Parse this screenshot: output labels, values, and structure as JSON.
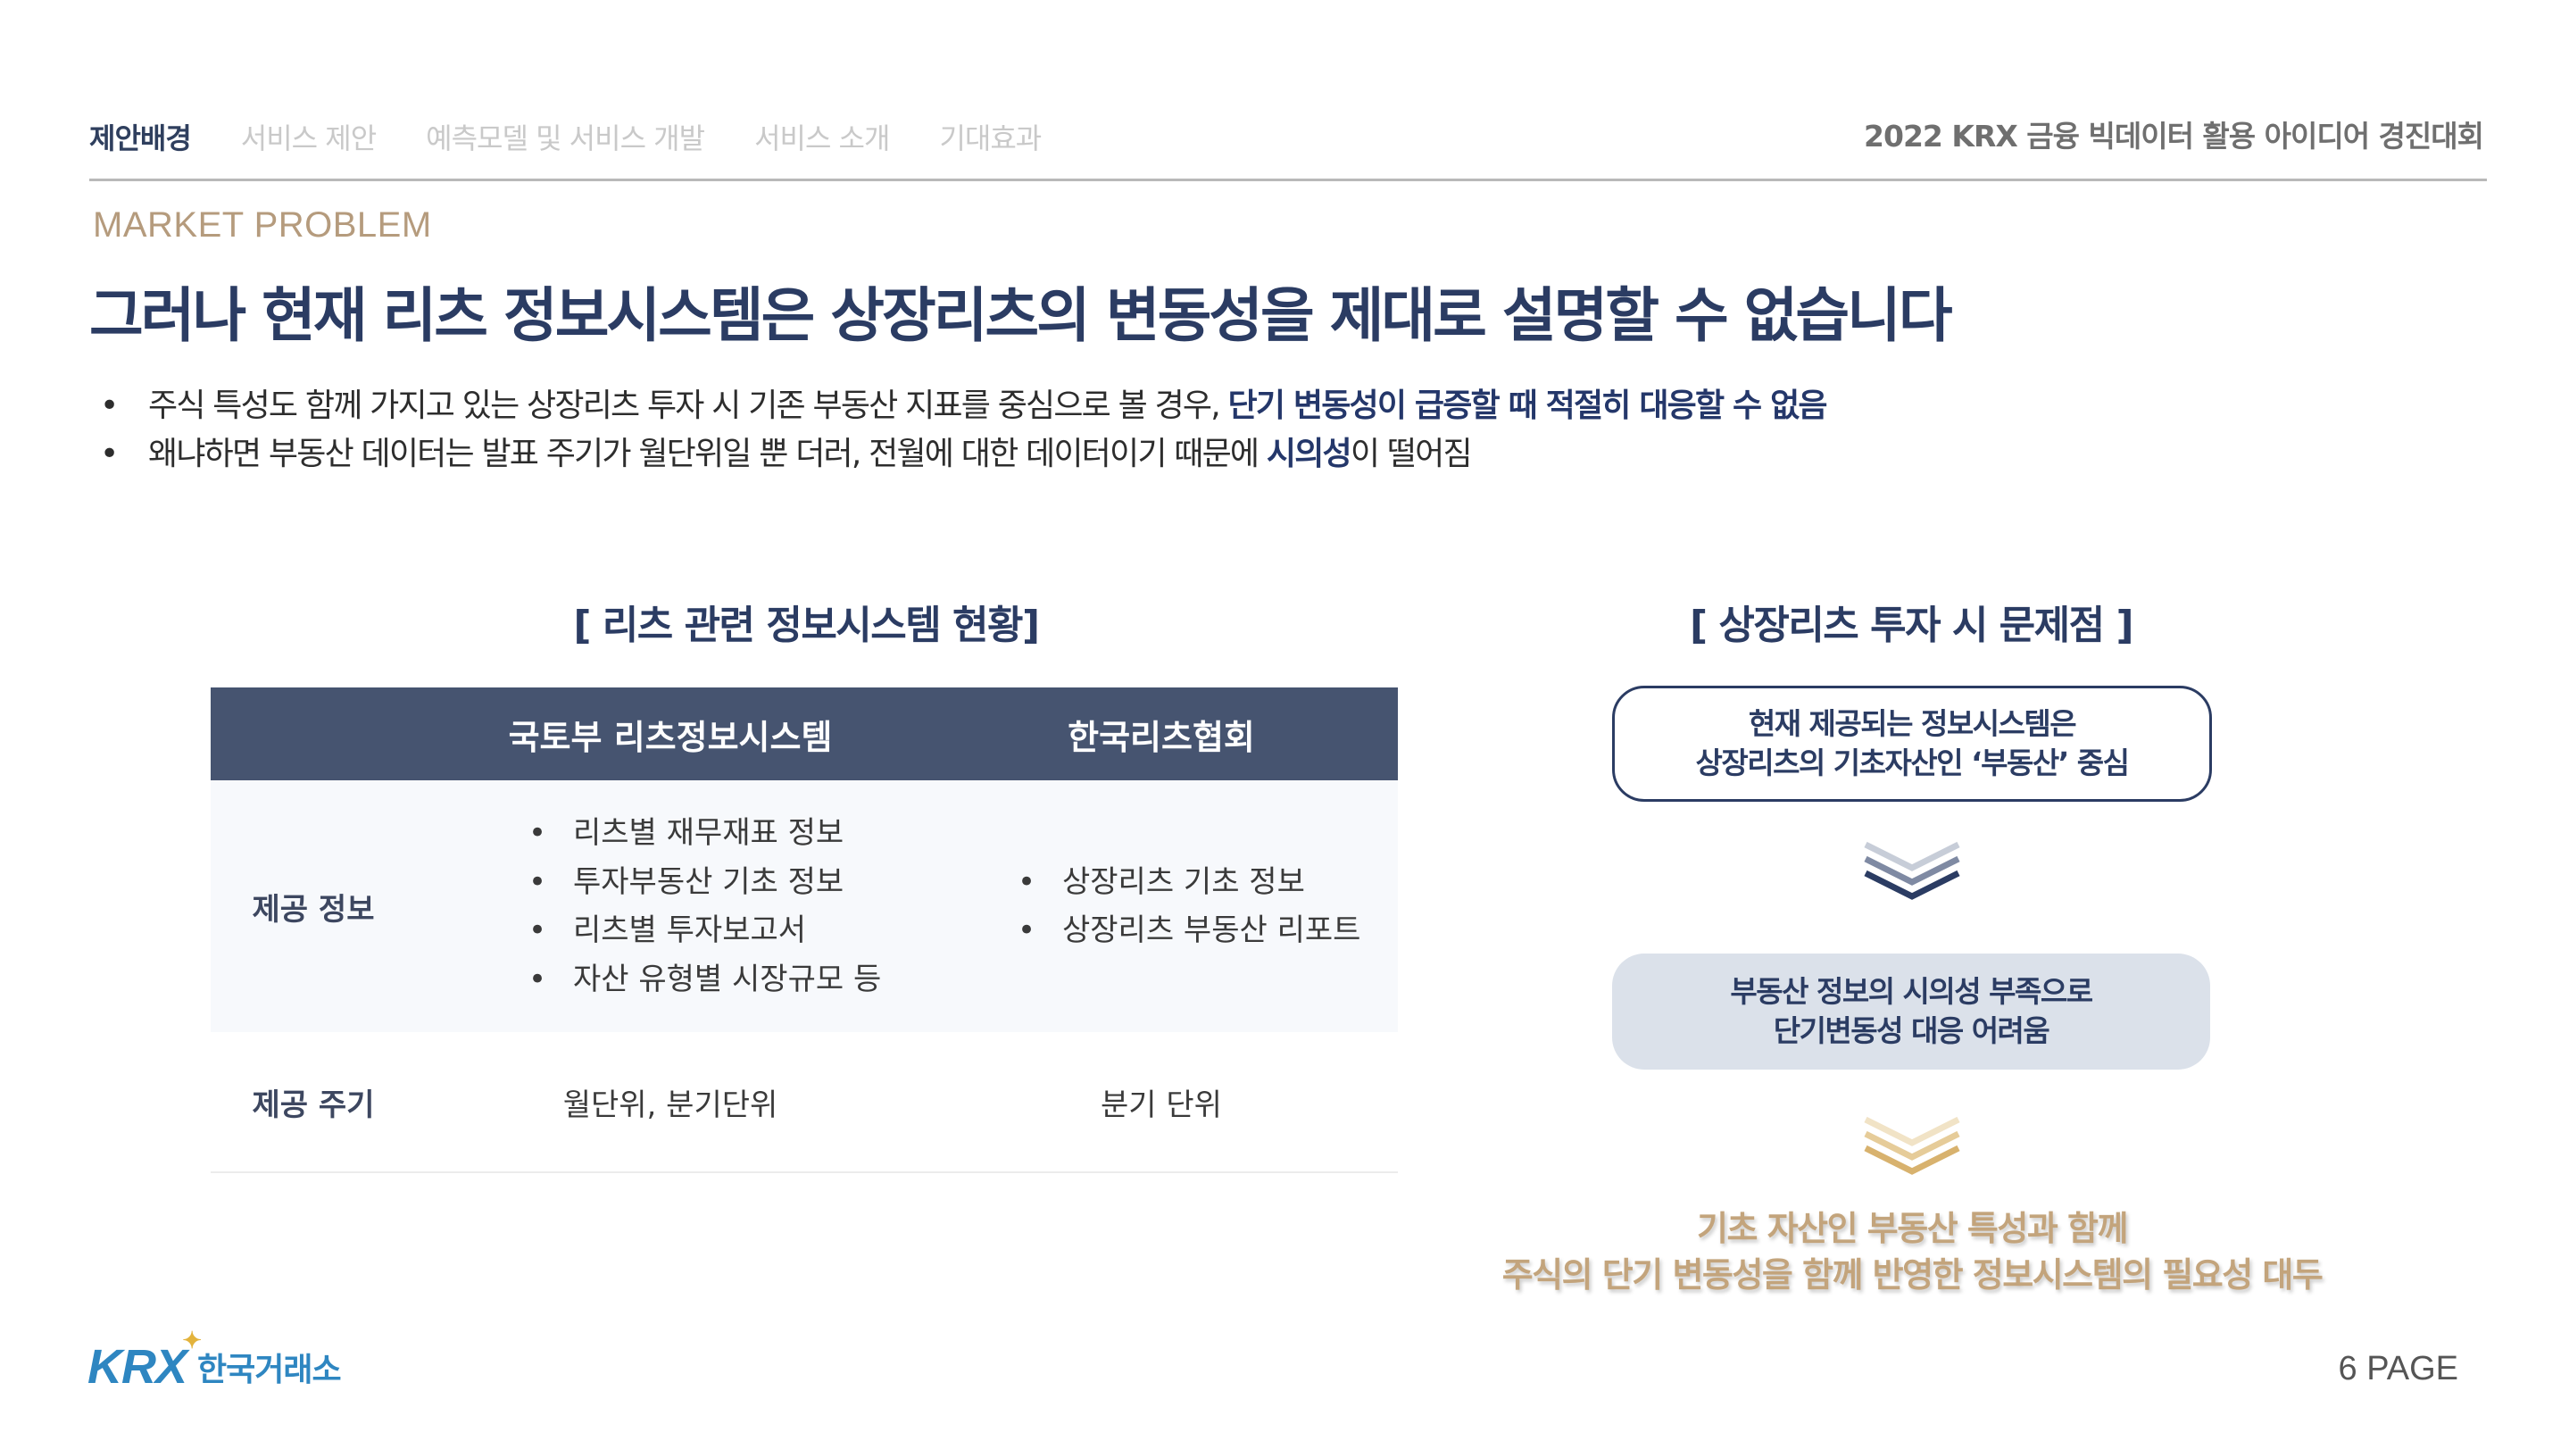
{
  "nav": {
    "tabs": [
      {
        "label": "제안배경",
        "active": true
      },
      {
        "label": "서비스 제안",
        "active": false
      },
      {
        "label": "예측모델 및 서비스 개발",
        "active": false
      },
      {
        "label": "서비스 소개",
        "active": false
      },
      {
        "label": "기대효과",
        "active": false
      }
    ],
    "event_name": "2022 KRX 금융 빅데이터 활용 아이디어 경진대회"
  },
  "section_label": "MARKET PROBLEM",
  "headline": "그러나 현재 리츠 정보시스템은 상장리츠의 변동성을 제대로 설명할 수 없습니다",
  "bullets": [
    {
      "text": "주식 특성도 함께 가지고 있는 상장리츠 투자 시 기존 부동산 지표를 중심으로 볼 경우, ",
      "highlight": "단기 변동성이 급증할 때 적절히 대응할 수 없음",
      "tail": ""
    },
    {
      "text": "왜냐하면 부동산 데이터는 발표 주기가 월단위일 뿐 더러, 전월에 대한 데이터이기 때문에 ",
      "highlight": "시의성",
      "tail": "이 떨어짐"
    }
  ],
  "left_title": "[ 리츠 관련 정보시스템 현황]",
  "right_title": "[ 상장리츠 투자 시 문제점 ]",
  "table": {
    "headers": [
      "",
      "국토부 리츠정보시스템",
      "한국리츠협회"
    ],
    "rows": [
      {
        "label": "제공 정보",
        "col1": [
          "리츠별 재무재표 정보",
          "투자부동산 기초 정보",
          "리츠별 투자보고서",
          "자산 유형별 시장규모 등"
        ],
        "col2": [
          "상장리츠 기초 정보",
          "상장리츠 부동산 리포트"
        ]
      },
      {
        "label": "제공 주기",
        "col1": "월단위, 분기단위",
        "col2": "분기 단위"
      }
    ]
  },
  "flow": {
    "box1": [
      "현재 제공되는 정보시스템은",
      "상장리츠의 기초자산인 ‘부동산’ 중심"
    ],
    "box2": [
      "부동산 정보의 시의성 부족으로",
      "단기변동성 대응 어려움"
    ],
    "conclusion": [
      "기초 자산인 부동산 특성과 함께",
      "주식의 단기 변동성을 함께 반영한 정보시스템의 필요성 대두"
    ],
    "chevron1_color": "#2b3c63",
    "chevron2_color": "#d8b26e"
  },
  "footer": {
    "logo_mark": "KRX",
    "logo_text": "한국거래소",
    "page": "6 PAGE"
  },
  "colors": {
    "navy": "#2b3c63",
    "table_header": "#465470",
    "accent_tan": "#b59b7d",
    "gold": "#c3a47c",
    "krx_blue": "#2e86c1"
  }
}
